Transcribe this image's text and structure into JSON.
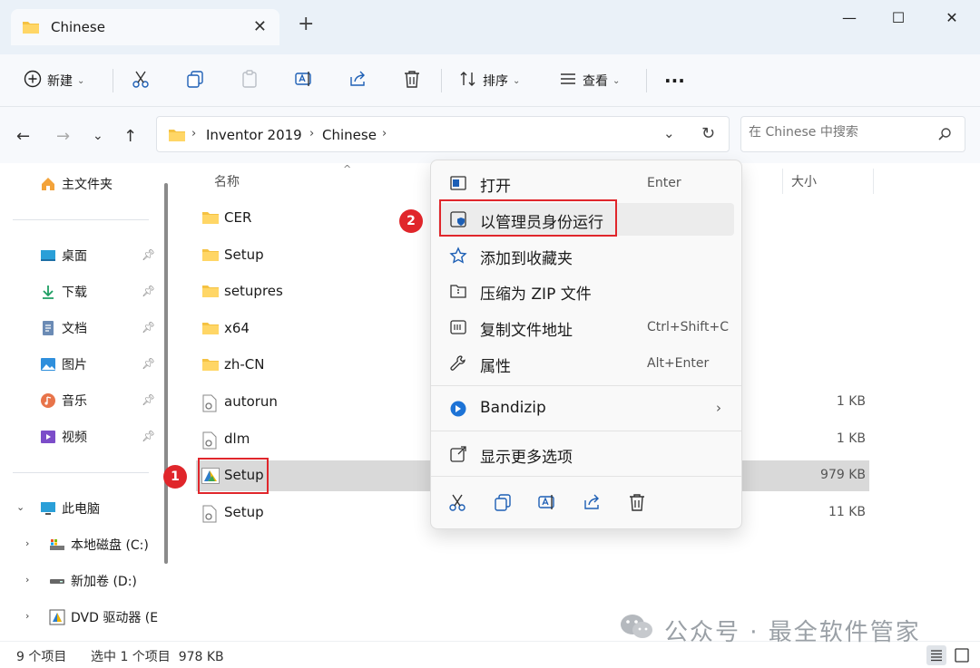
{
  "window": {
    "tab_title": "Chinese",
    "tab_close": "✕",
    "new_tab": "+",
    "minimize": "—",
    "maximize": "☐",
    "close": "✕"
  },
  "toolbar": {
    "new_label": "新建",
    "sort_label": "排序",
    "view_label": "查看",
    "more_label": "···",
    "icons": [
      "plus-circle-icon",
      "cut-icon",
      "copy-icon",
      "paste-icon",
      "rename-icon",
      "share-icon",
      "delete-icon",
      "sort-icon",
      "view-icon",
      "more-icon"
    ]
  },
  "address": {
    "crumbs": [
      "Inventor 2019",
      "Chinese"
    ],
    "search_placeholder": "在 Chinese 中搜索"
  },
  "sidebar": {
    "home": "主文件夹",
    "quick": [
      {
        "label": "桌面",
        "icon": "desktop-icon"
      },
      {
        "label": "下载",
        "icon": "download-icon"
      },
      {
        "label": "文档",
        "icon": "documents-icon"
      },
      {
        "label": "图片",
        "icon": "pictures-icon"
      },
      {
        "label": "音乐",
        "icon": "music-icon"
      },
      {
        "label": "视频",
        "icon": "videos-icon"
      }
    ],
    "this_pc": "此电脑",
    "drives": [
      {
        "label": "本地磁盘 (C:)",
        "icon": "local-disk-icon"
      },
      {
        "label": "新加卷 (D:)",
        "icon": "drive-icon"
      },
      {
        "label": "DVD 驱动器 (E",
        "icon": "dvd-drive-icon"
      }
    ]
  },
  "files": {
    "col_name": "名称",
    "col_size": "大小",
    "rows": [
      {
        "name": "CER",
        "type": "folder",
        "size": ""
      },
      {
        "name": "Setup",
        "type": "folder",
        "size": ""
      },
      {
        "name": "setupres",
        "type": "folder",
        "size": ""
      },
      {
        "name": "x64",
        "type": "folder",
        "size": ""
      },
      {
        "name": "zh-CN",
        "type": "folder",
        "size": ""
      },
      {
        "name": "autorun",
        "type": "file",
        "size": "1 KB"
      },
      {
        "name": "dlm",
        "type": "file",
        "size": "1 KB"
      },
      {
        "name": "Setup",
        "type": "app",
        "size": "979 KB",
        "selected": true
      },
      {
        "name": "Setup",
        "type": "file",
        "size": "11 KB"
      }
    ]
  },
  "context_menu": {
    "items": [
      {
        "label": "打开",
        "key": "Enter",
        "icon": "open-icon"
      },
      {
        "label": "以管理员身份运行",
        "key": "",
        "icon": "shield-icon"
      },
      {
        "label": "添加到收藏夹",
        "key": "",
        "icon": "star-icon"
      },
      {
        "label": "压缩为 ZIP 文件",
        "key": "",
        "icon": "zip-icon"
      },
      {
        "label": "复制文件地址",
        "key": "Ctrl+Shift+C",
        "icon": "copy-path-icon"
      },
      {
        "label": "属性",
        "key": "Alt+Enter",
        "icon": "wrench-icon"
      },
      {
        "label": "Bandizip",
        "key": "",
        "icon": "bandizip-icon"
      },
      {
        "label": "显示更多选项",
        "key": "",
        "icon": "more-options-icon"
      }
    ],
    "quick_actions": [
      "cut-icon",
      "copy-icon",
      "rename-icon",
      "share-icon",
      "delete-icon"
    ],
    "submenu_arrow": "›"
  },
  "annotations": {
    "badge1": "1",
    "badge2": "2",
    "color": "#e0262b"
  },
  "status": {
    "count": "9 个项目",
    "selected": "选中 1 个项目  978 KB"
  },
  "watermark": "公众号 · 最全软件管家"
}
